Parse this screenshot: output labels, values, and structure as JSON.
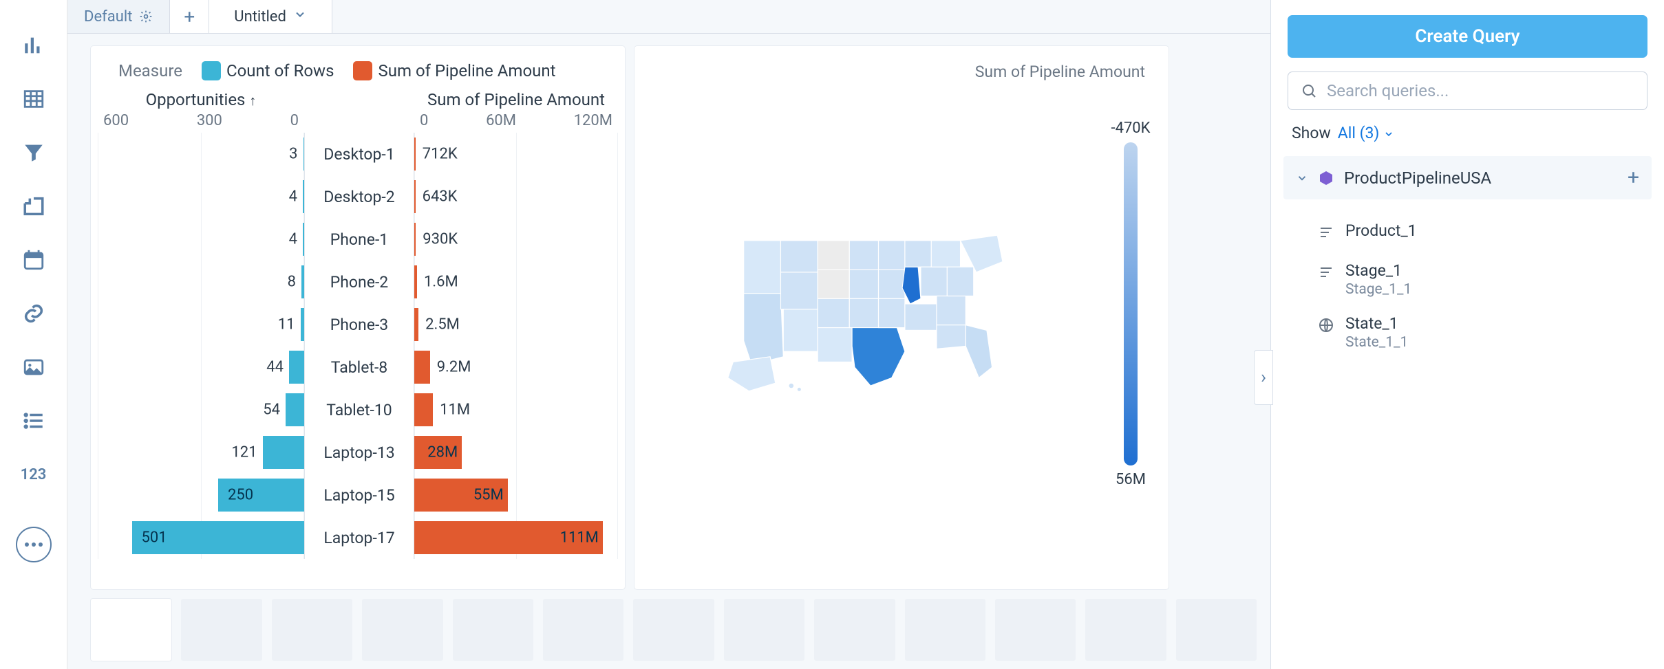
{
  "tabs": {
    "default": "Default",
    "untitled": "Untitled"
  },
  "legend": {
    "label": "Measure",
    "count": "Count of Rows",
    "sum": "Sum of Pipeline Amount"
  },
  "left_axis": {
    "title": "Opportunities",
    "sort": "↑",
    "ticks": [
      "600",
      "300",
      "0"
    ]
  },
  "right_axis": {
    "title": "Sum of Pipeline Amount",
    "ticks": [
      "0",
      "60M",
      "120M"
    ]
  },
  "map": {
    "title": "Sum of Pipeline Amount",
    "scale_top": "-470K",
    "scale_bottom": "56M"
  },
  "side": {
    "create": "Create Query",
    "search_placeholder": "Search queries...",
    "show": "Show",
    "all": "All (3)",
    "dataset": "ProductPipelineUSA",
    "queries": [
      {
        "name": "Product_1",
        "sub": ""
      },
      {
        "name": "Stage_1",
        "sub": "Stage_1_1"
      },
      {
        "name": "State_1",
        "sub": "State_1_1"
      }
    ]
  },
  "rail_num": "123",
  "chart_data": {
    "type": "bar",
    "categories": [
      "Desktop-1",
      "Desktop-2",
      "Phone-1",
      "Phone-2",
      "Phone-3",
      "Tablet-8",
      "Tablet-10",
      "Laptop-13",
      "Laptop-15",
      "Laptop-17"
    ],
    "series": [
      {
        "name": "Count of Rows",
        "values": [
          3,
          4,
          4,
          8,
          11,
          44,
          54,
          121,
          250,
          501
        ],
        "labels": [
          "3",
          "4",
          "4",
          "8",
          "11",
          "44",
          "54",
          "121",
          "250",
          "501"
        ],
        "axis_max": 600
      },
      {
        "name": "Sum of Pipeline Amount",
        "values": [
          712000,
          643000,
          930000,
          1600000,
          2500000,
          9200000,
          11000000,
          28000000,
          55000000,
          111000000
        ],
        "labels": [
          "712K",
          "643K",
          "930K",
          "1.6M",
          "2.5M",
          "9.2M",
          "11M",
          "28M",
          "55M",
          "111M"
        ],
        "axis_max": 120000000
      }
    ]
  }
}
